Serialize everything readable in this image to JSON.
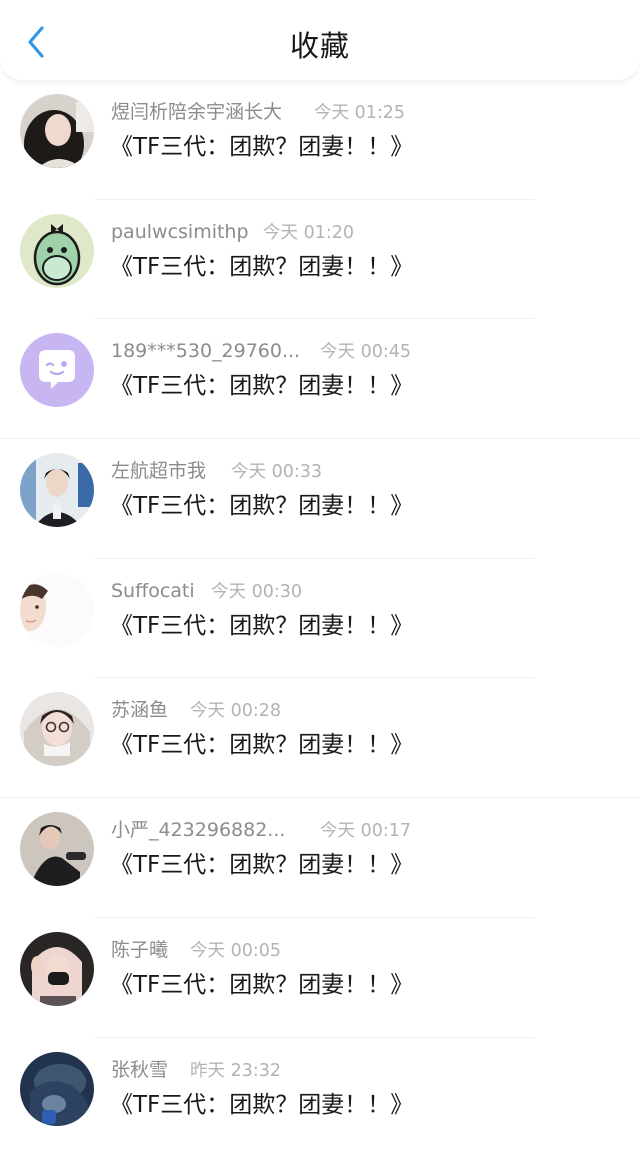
{
  "header": {
    "title": "收藏"
  },
  "items": [
    {
      "name": "煜闫析陪余宇涵长大",
      "time": "今天 01:25",
      "message": "《TF三代：团欺？团妻！！》"
    },
    {
      "name": "paulwcsimithp",
      "time": "今天 01:20",
      "message": "《TF三代：团欺？团妻！！》"
    },
    {
      "name": "189***530_29760...",
      "time": "今天 00:45",
      "message": "《TF三代：团欺？团妻！！》"
    },
    {
      "name": "左航超市我",
      "time": "今天 00:33",
      "message": "《TF三代：团欺？团妻！！》"
    },
    {
      "name": "Suffocati",
      "time": "今天 00:30",
      "message": "《TF三代：团欺？团妻！！》"
    },
    {
      "name": "苏涵鱼",
      "time": "今天 00:28",
      "message": "《TF三代：团欺？团妻！！》"
    },
    {
      "name": "小严_423296882...",
      "time": "今天 00:17",
      "message": "《TF三代：团欺？团妻！！》"
    },
    {
      "name": "陈子曦",
      "time": "今天 00:05",
      "message": "《TF三代：团欺？团妻！！》"
    },
    {
      "name": "张秋雪",
      "time": "昨天 23:32",
      "message": "《TF三代：团欺？团妻！！》"
    }
  ],
  "colors": {
    "accent": "#2f97e8",
    "title": "#1a1a1a",
    "name": "#8c8c8c",
    "time": "#b3b3b3"
  }
}
